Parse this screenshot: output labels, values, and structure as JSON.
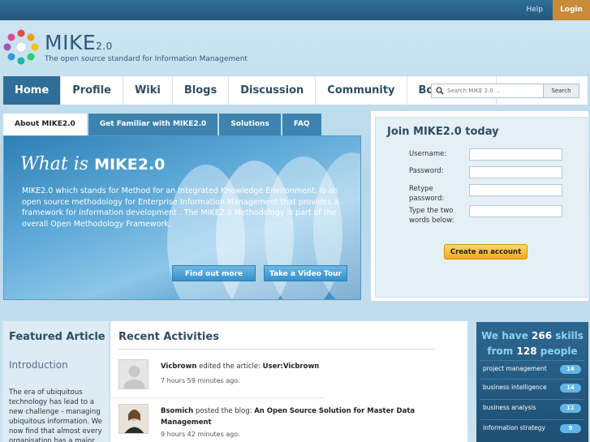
{
  "topbar": {
    "help": "Help",
    "login": "Login"
  },
  "brand": {
    "name": "MIKE",
    "version": "2.0",
    "tagline": "The open source standard for Information Management"
  },
  "nav": {
    "items": [
      "Home",
      "Profile",
      "Wiki",
      "Blogs",
      "Discussion",
      "Community",
      "Bookmarks"
    ],
    "active": "Home",
    "search_placeholder": "Search MIKE 2.0 ...",
    "search_button": "Search"
  },
  "tabs": [
    "About MIKE2.0",
    "Get Familiar with MIKE2.0",
    "Solutions",
    "FAQ"
  ],
  "hero": {
    "title_prefix": "What is",
    "title_brand": "MIKE2.0",
    "description": "MIKE2.0 which stands for Method for an Integrated Knowledge Environment, is an open source methodology for Enterprise Information Management that provides a framework for information development . The MIKE2.0 Methodology is part of the overall Open Methodology Framework.",
    "cta_1": "Find out more",
    "cta_2": "Take a Video Tour"
  },
  "join": {
    "title": "Join MIKE2.0 today",
    "username_label": "Username:",
    "password_label": "Password:",
    "retype_label": "Retype password:",
    "captcha_label": "Type the two words below:",
    "create_button": "Create an account"
  },
  "featured": {
    "heading": "Featured Article",
    "title": "Introduction",
    "excerpt": "The era of ubiquitous technology has lead to a new challenge - managing ubiquitous information. We now find that almost every organisation has a major"
  },
  "recent": {
    "heading": "Recent Activities",
    "items": [
      {
        "user": "Vicbrown",
        "action": "edited the article:",
        "target": "User:Vicbrown",
        "time": "7 hours 59 minutes ago."
      },
      {
        "user": "Bsomich",
        "action": "posted the blog:",
        "target": "An Open Source Solution for Master Data Management",
        "time": "9 hours 42 minutes ago."
      }
    ]
  },
  "skills": {
    "prefix": "We have",
    "skill_count": "266",
    "skills_word": "skills",
    "from_word": "from",
    "people_count": "128",
    "people_word": "people",
    "items": [
      {
        "label": "project management",
        "count": "14"
      },
      {
        "label": "business intelligence",
        "count": "14"
      },
      {
        "label": "business analysis",
        "count": "11"
      },
      {
        "label": "information strategy",
        "count": "9"
      }
    ]
  },
  "colors": {
    "accent": "#2f6e98",
    "login": "#c98a3a",
    "create": "#f3a91b"
  }
}
